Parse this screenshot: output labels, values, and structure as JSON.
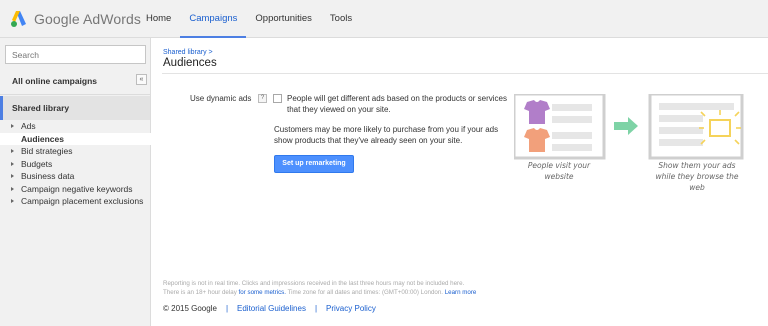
{
  "app": {
    "logo_text": "Google AdWords",
    "nav": [
      {
        "label": "Home"
      },
      {
        "label": "Campaigns",
        "active": true
      },
      {
        "label": "Opportunities"
      },
      {
        "label": "Tools"
      }
    ]
  },
  "sidebar": {
    "search_placeholder": "Search",
    "all_campaigns": "All online campaigns",
    "collapse_glyph": "«",
    "shared_library": "Shared library",
    "items": [
      {
        "label": "Ads",
        "caret": true
      },
      {
        "label": "Audiences",
        "caret": false,
        "selected": true
      },
      {
        "label": "Bid strategies",
        "caret": true
      },
      {
        "label": "Budgets",
        "caret": true
      },
      {
        "label": "Business data",
        "caret": true
      },
      {
        "label": "Campaign negative keywords",
        "caret": true
      },
      {
        "label": "Campaign placement exclusions",
        "caret": true
      }
    ]
  },
  "main": {
    "breadcrumb": "Shared library >",
    "title": "Audiences",
    "dynamic_ads_label": "Use dynamic ads",
    "help_glyph": "?",
    "description_1": "People will get different ads based on the products or services that they viewed on your site.",
    "description_2": "Customers may be more likely to purchase from you if your ads show products that they've already seen on your site.",
    "remarketing_button": "Set up remarketing",
    "illustration": {
      "caption_left": "People visit your website",
      "caption_right": "Show them your ads while they browse the web",
      "colors": {
        "shirt_purple": "#b17ec9",
        "shirt_orange": "#f2a07b",
        "arrow_green": "#7ed3a6",
        "sun_yellow": "#f5d35a"
      }
    }
  },
  "footer": {
    "note_line1": "Reporting is not in real time. Clicks and impressions received in the last three hours may not be included here.",
    "note_line2_pre": "There is an 18+ hour delay",
    "note_line2_link1": "for some metrics.",
    "note_line2_mid": "Time zone for all dates and times: (GMT+00:00) London.",
    "note_line2_link2": "Learn more",
    "copyright": "© 2015 Google",
    "editorial": "Editorial Guidelines",
    "privacy": "Privacy Policy",
    "divider": "|"
  },
  "colors": {
    "accent": "#1a5fcf",
    "button": "#4d90fe",
    "sidebar_bg": "#f1f1f1"
  }
}
